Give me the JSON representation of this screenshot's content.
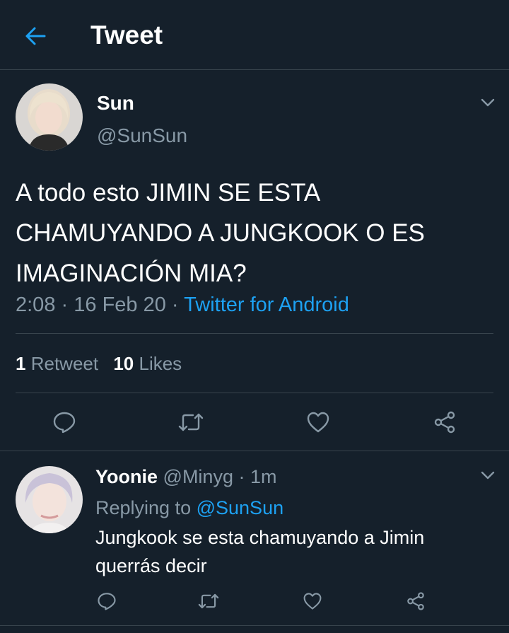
{
  "header": {
    "title": "Tweet",
    "back_icon": "arrow-left-icon"
  },
  "theme": {
    "background": "#15202b",
    "accent": "#1da1f2",
    "muted": "#8899a6",
    "divider": "#38444d"
  },
  "tweet": {
    "display_name": "Sun",
    "handle": "@SunSun",
    "text": "A todo esto JIMIN SE ESTA CHAMUYANDO A JUNGKOOK O ES IMAGINACIÓN MIA?",
    "time": "2:08",
    "date": "16 Feb 20",
    "source": "Twitter for Android",
    "separator": "·",
    "retweet_count": "1",
    "retweet_label": "Retweet",
    "like_count": "10",
    "like_label": "Likes",
    "actions": [
      "reply-icon",
      "retweet-icon",
      "like-icon",
      "share-icon"
    ]
  },
  "reply": {
    "display_name": "Yoonie",
    "handle": "@Minyg",
    "separator": "·",
    "age": "1m",
    "replying_label": "Replying to",
    "replying_handle": "@SunSun",
    "text": "Jungkook se esta chamuyando a Jimin querrás decir",
    "actions": [
      "reply-icon",
      "retweet-icon",
      "like-icon",
      "share-icon"
    ]
  }
}
